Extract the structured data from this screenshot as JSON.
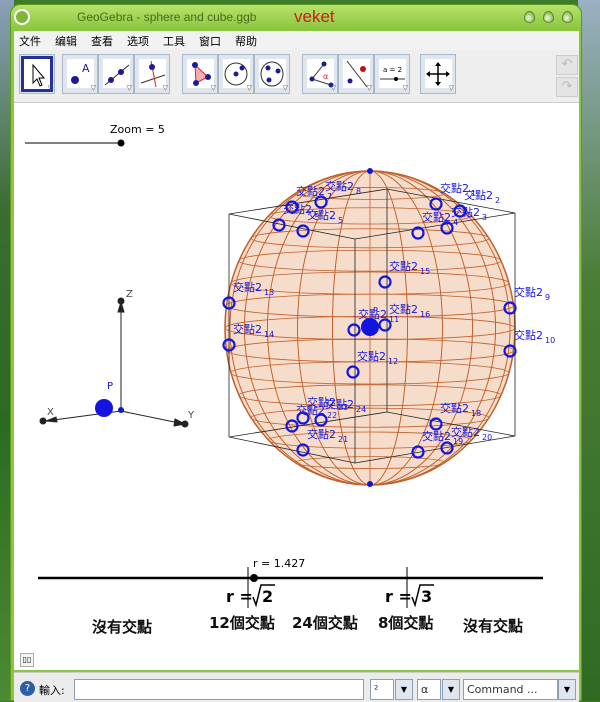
{
  "window": {
    "title": "GeoGebra - sphere and cube.ggb",
    "brand": "veket"
  },
  "menu": [
    "文件",
    "编辑",
    "查看",
    "选项",
    "工具",
    "窗口",
    "帮助"
  ],
  "toolbar": {
    "tools": [
      "move",
      "point",
      "line",
      "perpendicular-line",
      "polygon",
      "circle-center",
      "circle-three-points",
      "angle",
      "reflect",
      "slider",
      "move-graphics-view"
    ],
    "slider_icon_text": "a = 2",
    "angle_icon_text": "α",
    "point_icon_text": "A",
    "undo": "↶",
    "redo": "↷"
  },
  "graphics": {
    "slider_label": "Zoom = 5",
    "axes": {
      "x": "X",
      "y": "Y",
      "z": "Z",
      "point": "P"
    },
    "point_center_label": "P",
    "intersections": [
      {
        "name": "交點2",
        "sub": "7"
      },
      {
        "name": "交點2",
        "sub": "8"
      },
      {
        "name": "交點2",
        "sub": "6"
      },
      {
        "name": "交點2",
        "sub": "5"
      },
      {
        "name": "交點2",
        "sub": "1"
      },
      {
        "name": "交點2",
        "sub": "2"
      },
      {
        "name": "交點2",
        "sub": "3"
      },
      {
        "name": "交點2",
        "sub": "4"
      },
      {
        "name": "交點2",
        "sub": "15"
      },
      {
        "name": "交點2",
        "sub": "13"
      },
      {
        "name": "交點2",
        "sub": "9"
      },
      {
        "name": "交點2",
        "sub": "11"
      },
      {
        "name": "交點2",
        "sub": "16"
      },
      {
        "name": "交點2",
        "sub": "14"
      },
      {
        "name": "交點2",
        "sub": "10"
      },
      {
        "name": "交點2",
        "sub": "12"
      },
      {
        "name": "交點2",
        "sub": "22"
      },
      {
        "name": "交點2",
        "sub": "24"
      },
      {
        "name": "交點2",
        "sub": "23"
      },
      {
        "name": "交點2",
        "sub": "21"
      },
      {
        "name": "交點2",
        "sub": "18"
      },
      {
        "name": "交點2",
        "sub": "19"
      },
      {
        "name": "交點2",
        "sub": "20"
      }
    ],
    "r_slider": {
      "label": "r = 1.427",
      "value": 1.427
    },
    "sqrt2_label": "r =",
    "sqrt2": "2",
    "sqrt3_label": "r =",
    "sqrt3": "3",
    "regions": [
      "沒有交點",
      "12個交點",
      "24個交點",
      "8個交點",
      "沒有交點"
    ],
    "sphere_color": "#c0602a",
    "point_color": "#1414e0"
  },
  "input": {
    "help": "?",
    "label": "輸入:",
    "value": "",
    "sup_combo": "²",
    "alpha_combo": "α",
    "command_combo": "Command ...",
    "dropdown": "▼"
  },
  "view_toggle": "▯▯"
}
